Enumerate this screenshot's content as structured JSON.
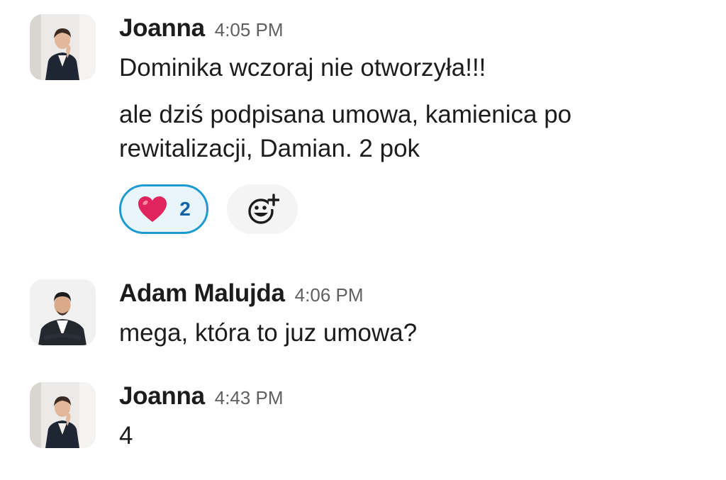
{
  "messages": [
    {
      "author": "Joanna",
      "time": "4:05 PM",
      "lines": [
        "Dominika wczoraj nie otworzyła!!!",
        "ale dziś podpisana umowa, kamienica po rewitalizacji, Damian. 2 pok"
      ],
      "reactions": [
        {
          "emoji": "heart-icon",
          "count": "2"
        }
      ],
      "add_reaction_icon": "add-emoji-icon"
    },
    {
      "author": "Adam Malujda",
      "time": "4:06 PM",
      "lines": [
        "mega, która to juz umowa?"
      ]
    },
    {
      "author": "Joanna",
      "time": "4:43 PM",
      "lines": [
        "4"
      ]
    }
  ],
  "colors": {
    "reaction_border": "#1d9bd1",
    "reaction_bg": "#e8f5fa",
    "reaction_count": "#1264a3",
    "heart": "#e0245e"
  }
}
